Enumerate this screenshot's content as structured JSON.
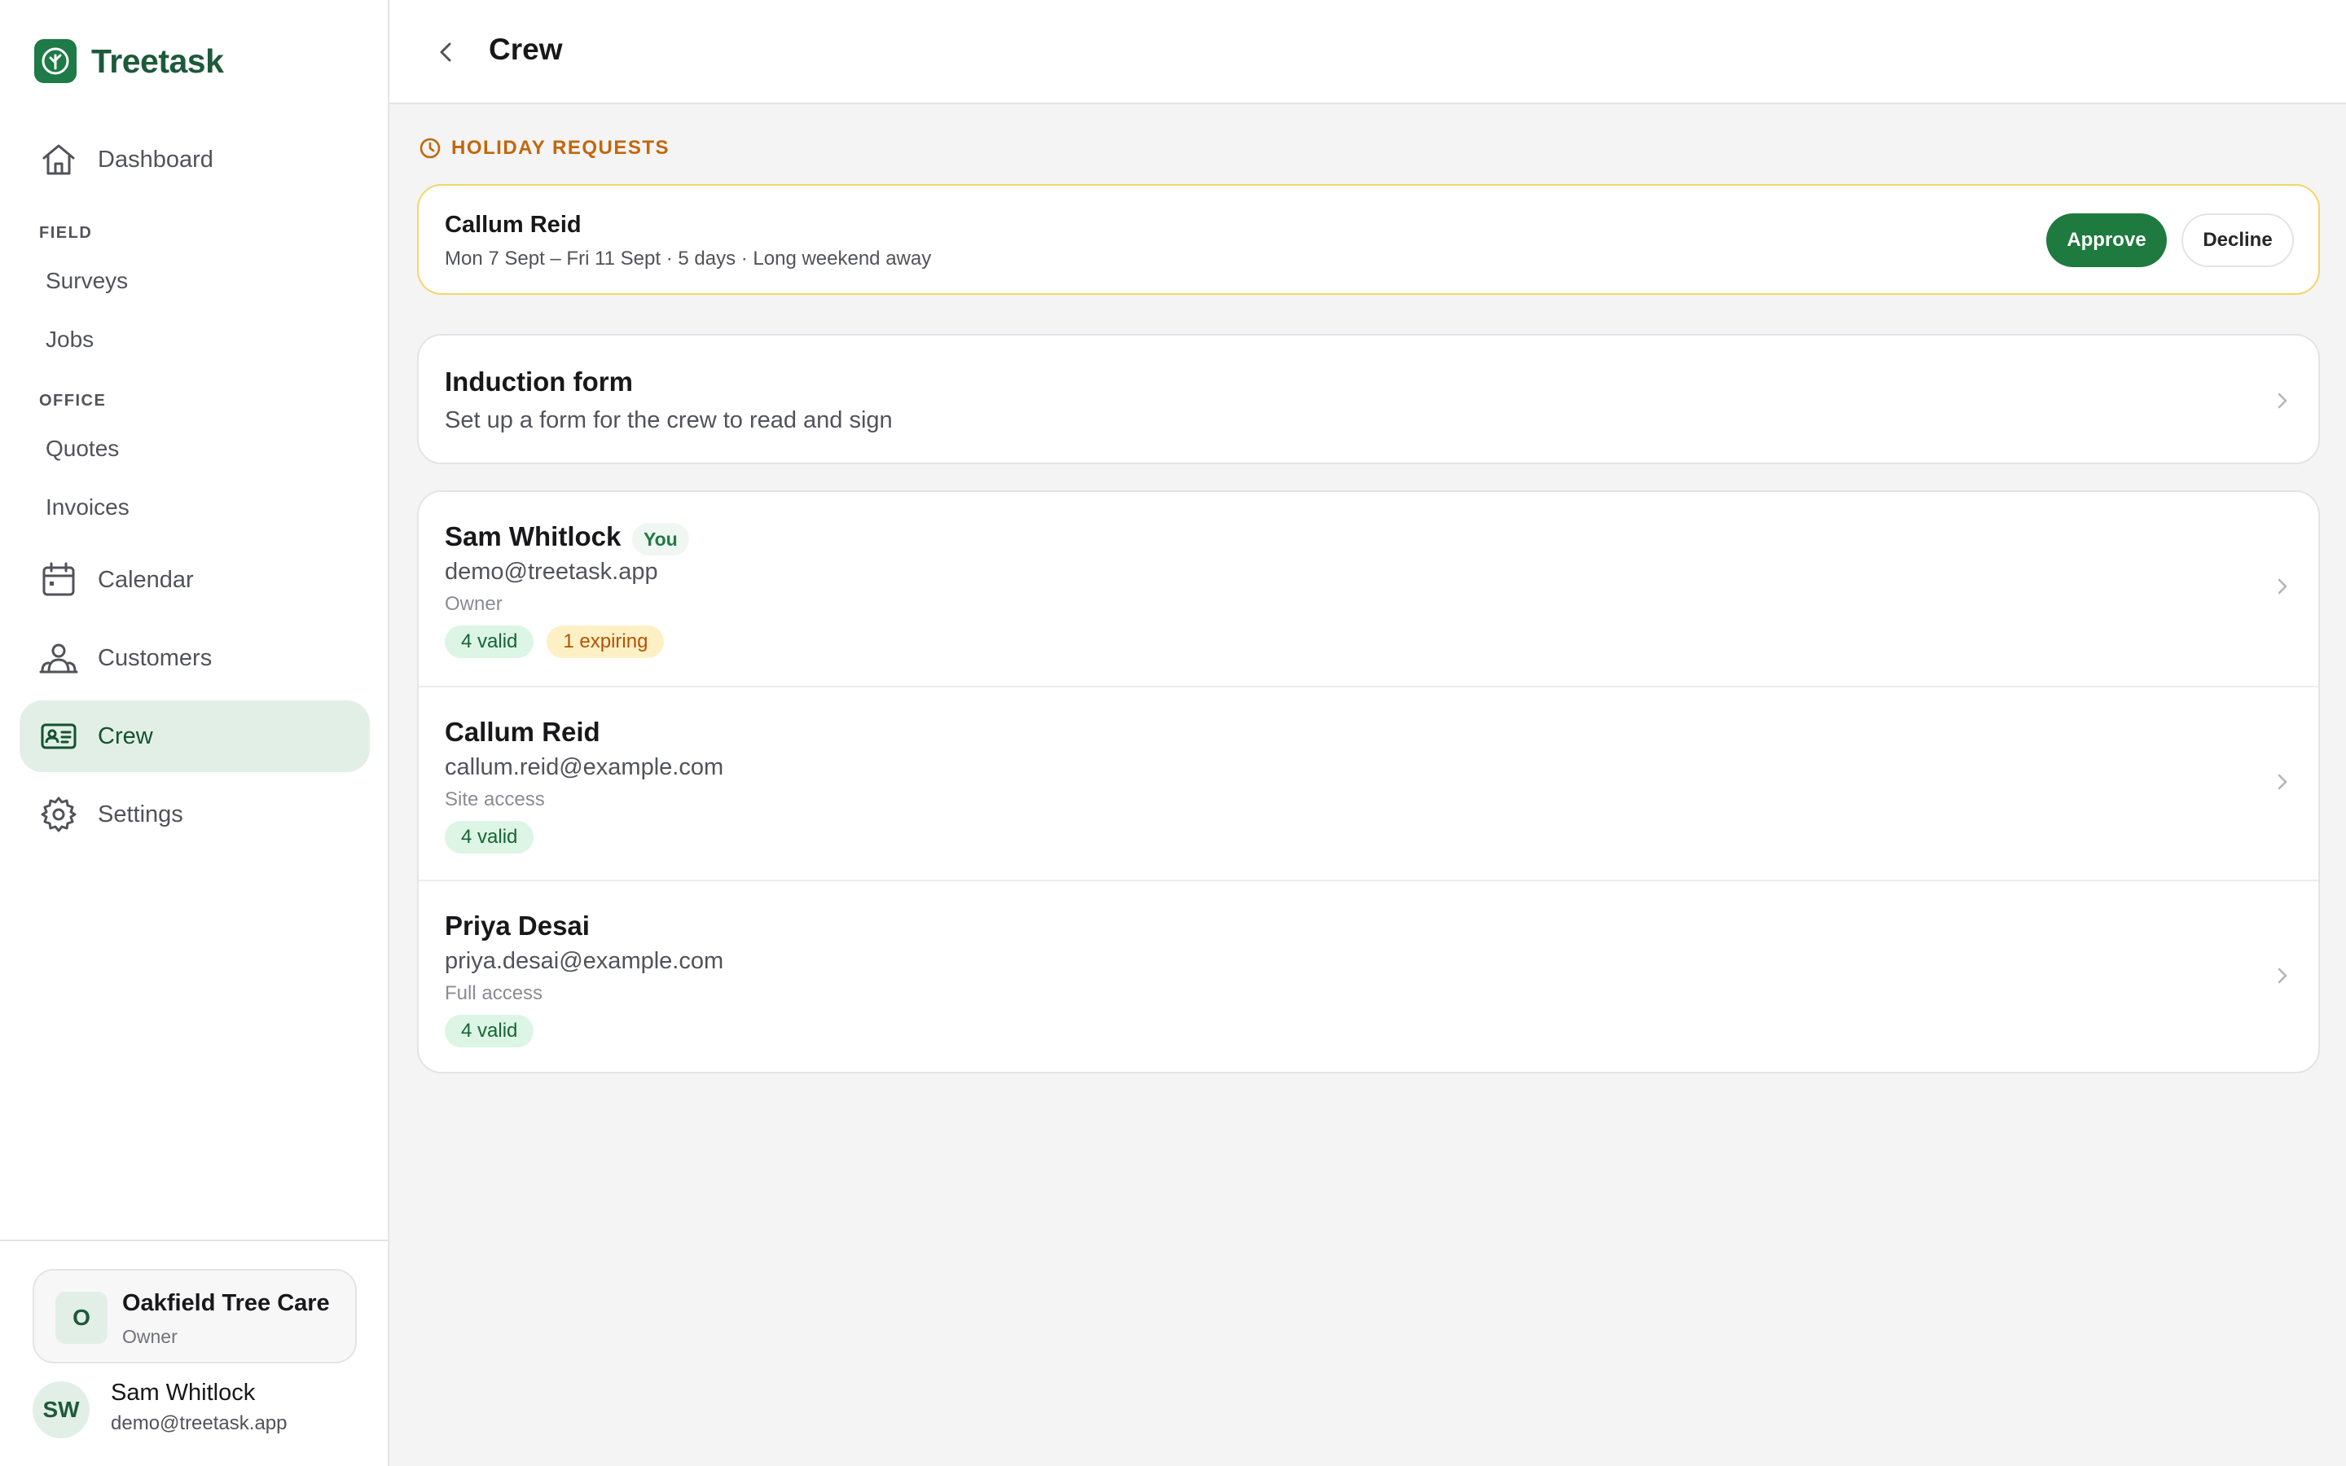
{
  "app": {
    "name": "Treetask"
  },
  "sidebar": {
    "dashboard": "Dashboard",
    "sections": {
      "field": "FIELD",
      "office": "OFFICE"
    },
    "field_items": [
      "Surveys",
      "Jobs"
    ],
    "office_items": [
      "Quotes",
      "Invoices"
    ],
    "calendar": "Calendar",
    "customers": "Customers",
    "crew": "Crew",
    "settings": "Settings",
    "active_item": "Crew",
    "org": {
      "avatar": "O",
      "name": "Oakfield Tree Care",
      "role": "Owner"
    },
    "user": {
      "initials": "SW",
      "name": "Sam Whitlock",
      "email": "demo@treetask.app"
    }
  },
  "header": {
    "title": "Crew"
  },
  "holiday": {
    "title": "HOLIDAY REQUESTS",
    "request": {
      "name": "Callum Reid",
      "details": "Mon 7 Sept – Fri 11 Sept · 5 days · Long weekend away"
    },
    "approve_label": "Approve",
    "decline_label": "Decline"
  },
  "induction": {
    "title": "Induction form",
    "description": "Set up a form for the crew to read and sign"
  },
  "crew": [
    {
      "name": "Sam Whitlock",
      "you_label": "You",
      "email": "demo@treetask.app",
      "role": "Owner",
      "valid": "4 valid",
      "expiring": "1 expiring"
    },
    {
      "name": "Callum Reid",
      "email": "callum.reid@example.com",
      "role": "Site access",
      "valid": "4 valid"
    },
    {
      "name": "Priya Desai",
      "email": "priya.desai@example.com",
      "role": "Full access",
      "valid": "4 valid"
    }
  ],
  "colors": {
    "brand": "#1e7a46",
    "accent_warning": "#c2670a",
    "active_nav_bg": "#e2efe6",
    "approve": "#1e7a3e"
  }
}
